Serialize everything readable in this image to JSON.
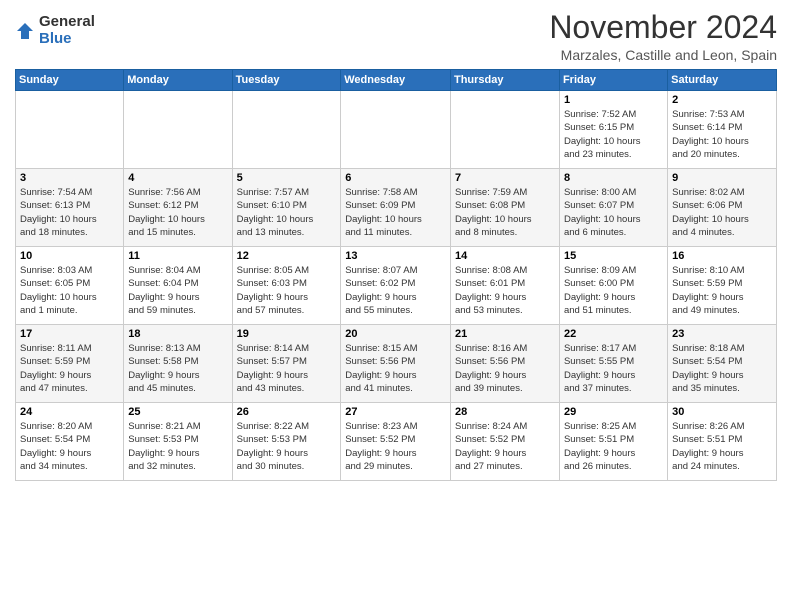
{
  "logo": {
    "general": "General",
    "blue": "Blue"
  },
  "title": "November 2024",
  "location": "Marzales, Castille and Leon, Spain",
  "days_header": [
    "Sunday",
    "Monday",
    "Tuesday",
    "Wednesday",
    "Thursday",
    "Friday",
    "Saturday"
  ],
  "weeks": [
    [
      {
        "day": "",
        "info": ""
      },
      {
        "day": "",
        "info": ""
      },
      {
        "day": "",
        "info": ""
      },
      {
        "day": "",
        "info": ""
      },
      {
        "day": "",
        "info": ""
      },
      {
        "day": "1",
        "info": "Sunrise: 7:52 AM\nSunset: 6:15 PM\nDaylight: 10 hours\nand 23 minutes."
      },
      {
        "day": "2",
        "info": "Sunrise: 7:53 AM\nSunset: 6:14 PM\nDaylight: 10 hours\nand 20 minutes."
      }
    ],
    [
      {
        "day": "3",
        "info": "Sunrise: 7:54 AM\nSunset: 6:13 PM\nDaylight: 10 hours\nand 18 minutes."
      },
      {
        "day": "4",
        "info": "Sunrise: 7:56 AM\nSunset: 6:12 PM\nDaylight: 10 hours\nand 15 minutes."
      },
      {
        "day": "5",
        "info": "Sunrise: 7:57 AM\nSunset: 6:10 PM\nDaylight: 10 hours\nand 13 minutes."
      },
      {
        "day": "6",
        "info": "Sunrise: 7:58 AM\nSunset: 6:09 PM\nDaylight: 10 hours\nand 11 minutes."
      },
      {
        "day": "7",
        "info": "Sunrise: 7:59 AM\nSunset: 6:08 PM\nDaylight: 10 hours\nand 8 minutes."
      },
      {
        "day": "8",
        "info": "Sunrise: 8:00 AM\nSunset: 6:07 PM\nDaylight: 10 hours\nand 6 minutes."
      },
      {
        "day": "9",
        "info": "Sunrise: 8:02 AM\nSunset: 6:06 PM\nDaylight: 10 hours\nand 4 minutes."
      }
    ],
    [
      {
        "day": "10",
        "info": "Sunrise: 8:03 AM\nSunset: 6:05 PM\nDaylight: 10 hours\nand 1 minute."
      },
      {
        "day": "11",
        "info": "Sunrise: 8:04 AM\nSunset: 6:04 PM\nDaylight: 9 hours\nand 59 minutes."
      },
      {
        "day": "12",
        "info": "Sunrise: 8:05 AM\nSunset: 6:03 PM\nDaylight: 9 hours\nand 57 minutes."
      },
      {
        "day": "13",
        "info": "Sunrise: 8:07 AM\nSunset: 6:02 PM\nDaylight: 9 hours\nand 55 minutes."
      },
      {
        "day": "14",
        "info": "Sunrise: 8:08 AM\nSunset: 6:01 PM\nDaylight: 9 hours\nand 53 minutes."
      },
      {
        "day": "15",
        "info": "Sunrise: 8:09 AM\nSunset: 6:00 PM\nDaylight: 9 hours\nand 51 minutes."
      },
      {
        "day": "16",
        "info": "Sunrise: 8:10 AM\nSunset: 5:59 PM\nDaylight: 9 hours\nand 49 minutes."
      }
    ],
    [
      {
        "day": "17",
        "info": "Sunrise: 8:11 AM\nSunset: 5:59 PM\nDaylight: 9 hours\nand 47 minutes."
      },
      {
        "day": "18",
        "info": "Sunrise: 8:13 AM\nSunset: 5:58 PM\nDaylight: 9 hours\nand 45 minutes."
      },
      {
        "day": "19",
        "info": "Sunrise: 8:14 AM\nSunset: 5:57 PM\nDaylight: 9 hours\nand 43 minutes."
      },
      {
        "day": "20",
        "info": "Sunrise: 8:15 AM\nSunset: 5:56 PM\nDaylight: 9 hours\nand 41 minutes."
      },
      {
        "day": "21",
        "info": "Sunrise: 8:16 AM\nSunset: 5:56 PM\nDaylight: 9 hours\nand 39 minutes."
      },
      {
        "day": "22",
        "info": "Sunrise: 8:17 AM\nSunset: 5:55 PM\nDaylight: 9 hours\nand 37 minutes."
      },
      {
        "day": "23",
        "info": "Sunrise: 8:18 AM\nSunset: 5:54 PM\nDaylight: 9 hours\nand 35 minutes."
      }
    ],
    [
      {
        "day": "24",
        "info": "Sunrise: 8:20 AM\nSunset: 5:54 PM\nDaylight: 9 hours\nand 34 minutes."
      },
      {
        "day": "25",
        "info": "Sunrise: 8:21 AM\nSunset: 5:53 PM\nDaylight: 9 hours\nand 32 minutes."
      },
      {
        "day": "26",
        "info": "Sunrise: 8:22 AM\nSunset: 5:53 PM\nDaylight: 9 hours\nand 30 minutes."
      },
      {
        "day": "27",
        "info": "Sunrise: 8:23 AM\nSunset: 5:52 PM\nDaylight: 9 hours\nand 29 minutes."
      },
      {
        "day": "28",
        "info": "Sunrise: 8:24 AM\nSunset: 5:52 PM\nDaylight: 9 hours\nand 27 minutes."
      },
      {
        "day": "29",
        "info": "Sunrise: 8:25 AM\nSunset: 5:51 PM\nDaylight: 9 hours\nand 26 minutes."
      },
      {
        "day": "30",
        "info": "Sunrise: 8:26 AM\nSunset: 5:51 PM\nDaylight: 9 hours\nand 24 minutes."
      }
    ]
  ]
}
